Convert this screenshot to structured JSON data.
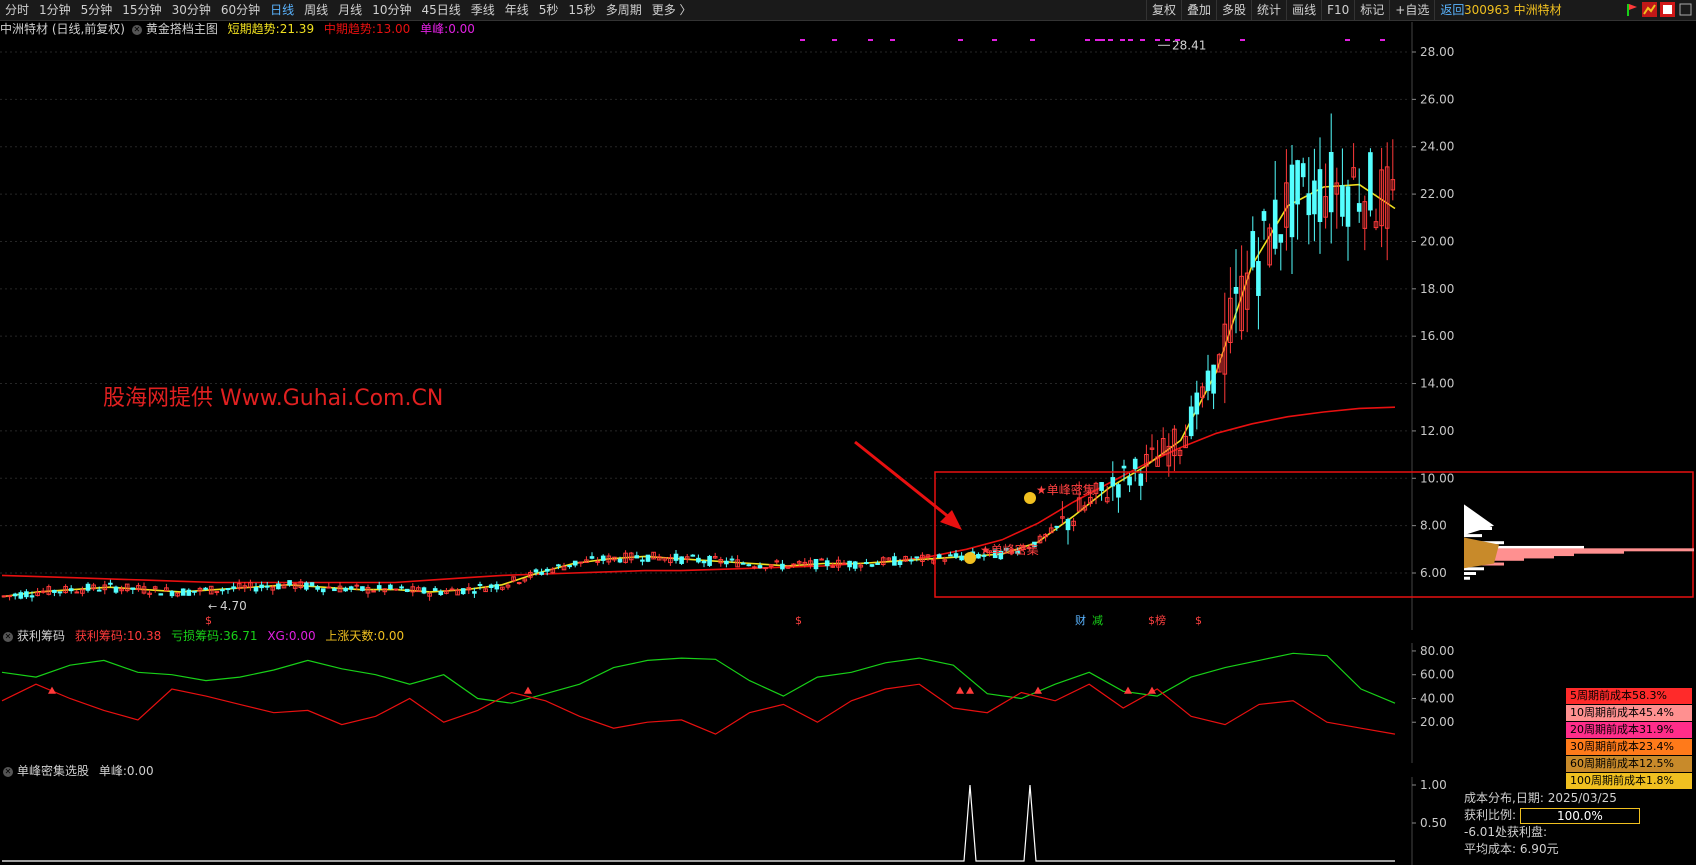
{
  "toolbar": {
    "periods": [
      "分时",
      "1分钟",
      "5分钟",
      "15分钟",
      "30分钟",
      "60分钟",
      "日线",
      "周线",
      "月线",
      "10分钟",
      "45日线",
      "季线",
      "年线",
      "5秒",
      "15秒",
      "多周期",
      "更多 〉"
    ],
    "active_period": "日线",
    "right_tools": [
      "复权",
      "叠加",
      "多股",
      "统计",
      "画线",
      "F10",
      "标记",
      "+自选",
      "返回"
    ],
    "stock_code": "300963 中洲特材"
  },
  "main_panel": {
    "title": "中洲特材 (日线,前复权)",
    "indicator": "黄金搭档主图",
    "short_trend_label": "短期趋势:",
    "short_trend_value": "21.39",
    "mid_trend_label": "中期趋势:",
    "mid_trend_value": "13.00",
    "peak_label": "单峰:",
    "peak_value": "0.00",
    "high_label": "28.41",
    "low_label": "4.70",
    "signal_label_1": "单峰密集",
    "signal_label_2": "单峰密集",
    "watermark": "股海网提供 Www.Guhai.Com.CN",
    "event_badges": [
      "$",
      "$",
      "财",
      "减",
      "$榜",
      "$"
    ]
  },
  "profit_panel": {
    "title": "获利筹码",
    "profit_label": "获利筹码:",
    "profit_value": "10.38",
    "loss_label": "亏损筹码:",
    "loss_value": "36.71",
    "xg_label": "XG:",
    "xg_value": "0.00",
    "up_days_label": "上涨天数:",
    "up_days_value": "0.00"
  },
  "peak_panel": {
    "title": "单峰密集选股",
    "peak_label": "单峰:",
    "peak_value": "0.00"
  },
  "cost_legend": [
    {
      "label": "5周期前成本58.3%",
      "color": "#ff2a2a"
    },
    {
      "label": "10周期前成本45.4%",
      "color": "#ff9090"
    },
    {
      "label": "20周期前成本31.9%",
      "color": "#ff2d8a"
    },
    {
      "label": "30周期前成本23.4%",
      "color": "#ff7a1a"
    },
    {
      "label": "60周期前成本12.5%",
      "color": "#c88a2a"
    },
    {
      "label": "100周期前成本1.8%",
      "color": "#f0c020"
    }
  ],
  "cost_info": {
    "date_label": "成本分布,日期:",
    "date_value": "2025/03/25",
    "profit_ratio_label": "获利比例:",
    "profit_ratio_value": "100.0%",
    "profit_disk": "-6.01处获利盘:",
    "avg_cost": "平均成本: 6.90元"
  },
  "colors": {
    "up": "#ff3a3a",
    "down": "#54ffff",
    "ma_short": "#f0e020",
    "ma_mid": "#e81010",
    "green_line": "#18d018"
  },
  "chart_data": [
    {
      "type": "line",
      "name": "main-price-chart",
      "title": "中洲特材 (日线,前复权)",
      "ylim": [
        4.7,
        28.41
      ],
      "y_ticks": [
        "6.00",
        "8.00",
        "10.00",
        "12.00",
        "14.00",
        "16.00",
        "18.00",
        "20.00",
        "22.00",
        "24.00",
        "26.00",
        "28.00"
      ],
      "high": 28.41,
      "low": 4.7,
      "series": [
        {
          "name": "短期趋势",
          "values": [
            5.0,
            5.2,
            5.3,
            5.4,
            5.3,
            5.2,
            5.3,
            5.4,
            5.5,
            5.4,
            5.3,
            5.3,
            5.2,
            5.3,
            5.5,
            6.0,
            6.4,
            6.6,
            6.7,
            6.6,
            6.5,
            6.4,
            6.3,
            6.4,
            6.4,
            6.5,
            6.6,
            6.7,
            6.8,
            7.3,
            8.4,
            9.6,
            10.5,
            11.6,
            14.5,
            19.0,
            21.5,
            22.3,
            22.4,
            21.39
          ]
        },
        {
          "name": "中期趋势",
          "values": [
            5.9,
            5.85,
            5.8,
            5.75,
            5.7,
            5.65,
            5.6,
            5.6,
            5.6,
            5.6,
            5.6,
            5.6,
            5.7,
            5.8,
            5.9,
            5.95,
            6.0,
            6.05,
            6.1,
            6.1,
            6.15,
            6.2,
            6.25,
            6.3,
            6.4,
            6.5,
            6.7,
            7.0,
            7.4,
            8.1,
            9.0,
            9.8,
            10.6,
            11.3,
            11.9,
            12.3,
            12.6,
            12.8,
            12.95,
            13.0
          ]
        }
      ]
    },
    {
      "type": "line",
      "name": "profit-chip-chart",
      "title": "获利筹码",
      "ylim": [
        0,
        90
      ],
      "y_ticks": [
        "20.00",
        "40.00",
        "60.00",
        "80.00"
      ],
      "series": [
        {
          "name": "获利筹码",
          "values": [
            38,
            52,
            40,
            30,
            22,
            48,
            42,
            35,
            28,
            30,
            18,
            25,
            40,
            20,
            30,
            45,
            38,
            25,
            15,
            20,
            22,
            10,
            28,
            35,
            20,
            38,
            48,
            52,
            32,
            28,
            45,
            38,
            52,
            32,
            48,
            25,
            18,
            35,
            38,
            20,
            15,
            10
          ]
        },
        {
          "name": "亏损筹码",
          "values": [
            62,
            58,
            68,
            72,
            62,
            60,
            55,
            58,
            64,
            72,
            65,
            60,
            52,
            60,
            40,
            36,
            44,
            52,
            66,
            72,
            74,
            73,
            55,
            42,
            58,
            62,
            70,
            74,
            68,
            44,
            40,
            52,
            62,
            46,
            42,
            58,
            66,
            72,
            78,
            76,
            48,
            36
          ]
        }
      ]
    },
    {
      "type": "line",
      "name": "single-peak-chart",
      "title": "单峰密集选股",
      "ylim": [
        0,
        1.1
      ],
      "y_ticks": [
        "0.50",
        "1.00"
      ],
      "series": [
        {
          "name": "单峰",
          "values": [
            0,
            0,
            0,
            0,
            0,
            0,
            0,
            0,
            0,
            0,
            0,
            0,
            0,
            0,
            0,
            0,
            0,
            0,
            0,
            0,
            0,
            0,
            0,
            0,
            0,
            0,
            0,
            0,
            1,
            0,
            0,
            1,
            0,
            0,
            0,
            0,
            0,
            0,
            0,
            0,
            0,
            0
          ]
        }
      ]
    }
  ]
}
